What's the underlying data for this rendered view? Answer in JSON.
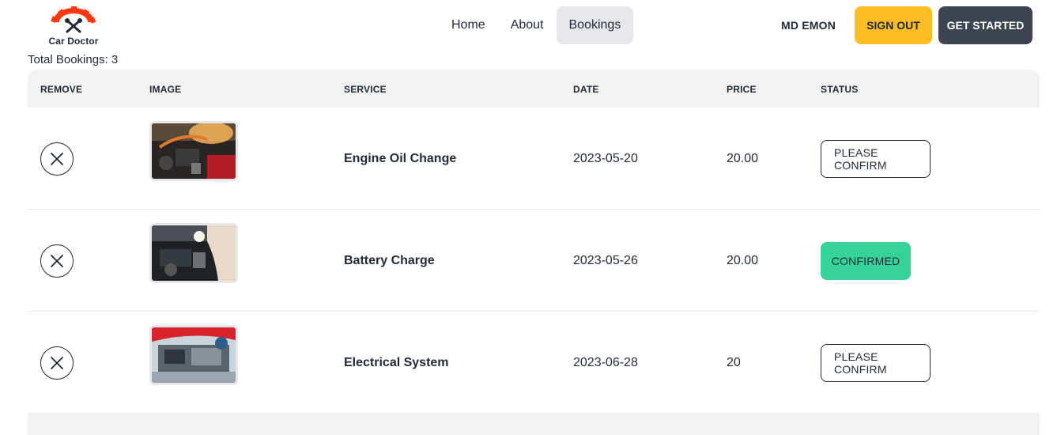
{
  "brand": {
    "name": "Car Doctor"
  },
  "nav": {
    "links": [
      {
        "label": "Home"
      },
      {
        "label": "About"
      },
      {
        "label": "Bookings"
      }
    ],
    "user_name": "MD EMON",
    "signout_label": "SIGN OUT",
    "get_started_label": "GET STARTED"
  },
  "summary": {
    "total_bookings_text": "Total Bookings: 3"
  },
  "table": {
    "headers": [
      "REMOVE",
      "IMAGE",
      "SERVICE",
      "DATE",
      "PRICE",
      "STATUS"
    ],
    "rows": [
      {
        "service": "Engine Oil Change",
        "date": "2023-05-20",
        "price": "20.00",
        "status": "PLEASE CONFIRM",
        "status_type": "pending"
      },
      {
        "service": "Battery Charge",
        "date": "2023-05-26",
        "price": "20.00",
        "status": "CONFIRMED",
        "status_type": "confirmed"
      },
      {
        "service": "Electrical System",
        "date": "2023-06-28",
        "price": "20",
        "status": "PLEASE CONFIRM",
        "status_type": "pending"
      }
    ]
  },
  "colors": {
    "brand_accent": "#ff3811",
    "signout_bg": "#fbbd23",
    "get_started_bg": "#3d4451",
    "confirmed_bg": "#36d399",
    "active_nav_bg": "#e5e7eb",
    "table_header_bg": "#f2f2f2"
  },
  "icons": {
    "logo": "gear-wrench-logo-icon",
    "remove": "close-icon"
  }
}
